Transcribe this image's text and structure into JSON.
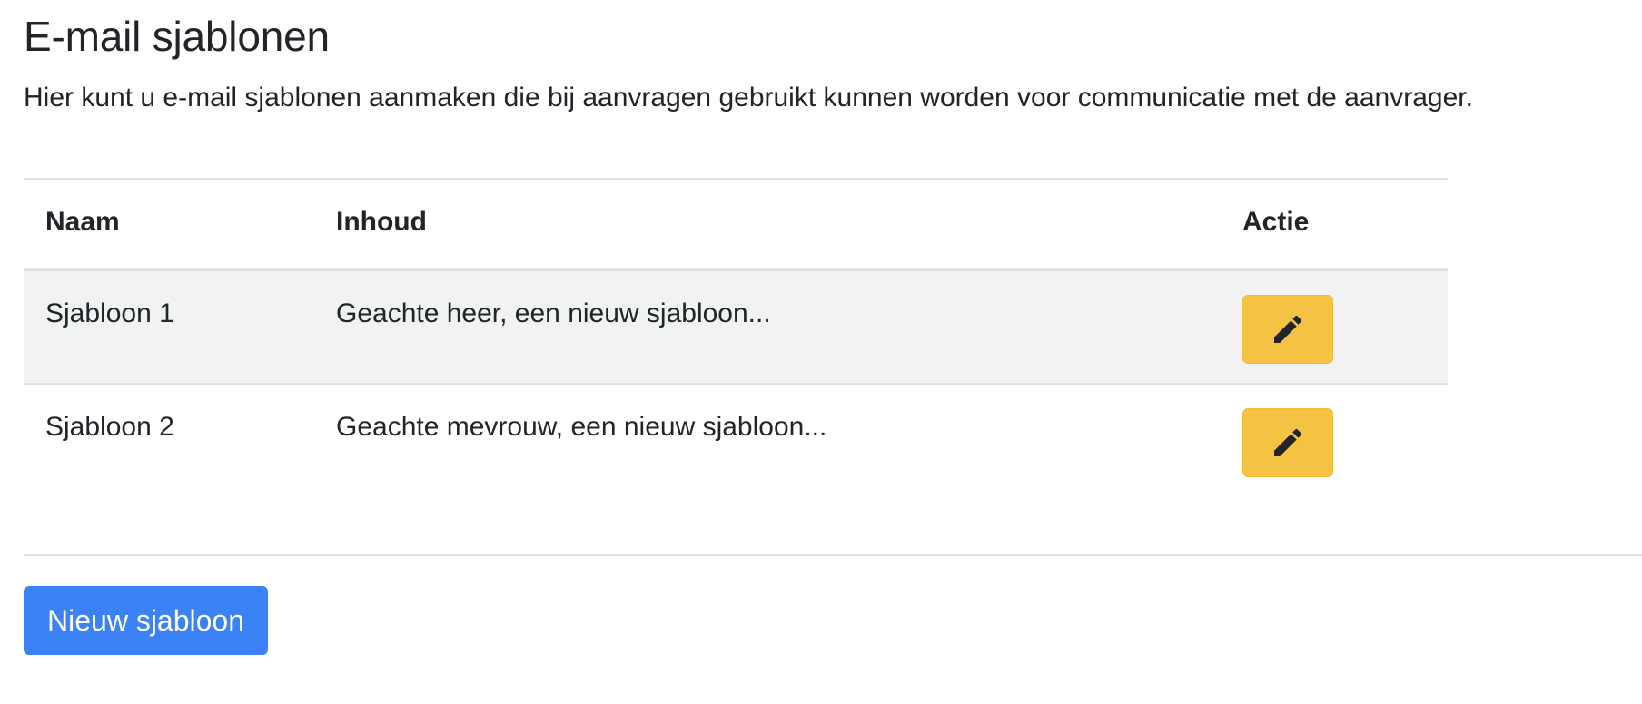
{
  "page": {
    "title": "E-mail sjablonen",
    "intro": "Hier kunt u e-mail sjablonen aanmaken die bij aanvragen gebruikt kunnen worden voor communicatie met de aanvrager."
  },
  "table": {
    "headers": {
      "name": "Naam",
      "content": "Inhoud",
      "action": "Actie"
    },
    "rows": [
      {
        "name": "Sjabloon 1",
        "content": "Geachte heer, een nieuw sjabloon...",
        "action_icon": "pencil-icon"
      },
      {
        "name": "Sjabloon 2",
        "content": "Geachte mevrouw, een nieuw sjabloon...",
        "action_icon": "pencil-icon"
      }
    ]
  },
  "actions": {
    "new_template_label": "Nieuw sjabloon"
  },
  "colors": {
    "primary": "#3a82f6",
    "warning": "#f4c343",
    "row_stripe": "#f1f2f2",
    "text": "#212529"
  }
}
